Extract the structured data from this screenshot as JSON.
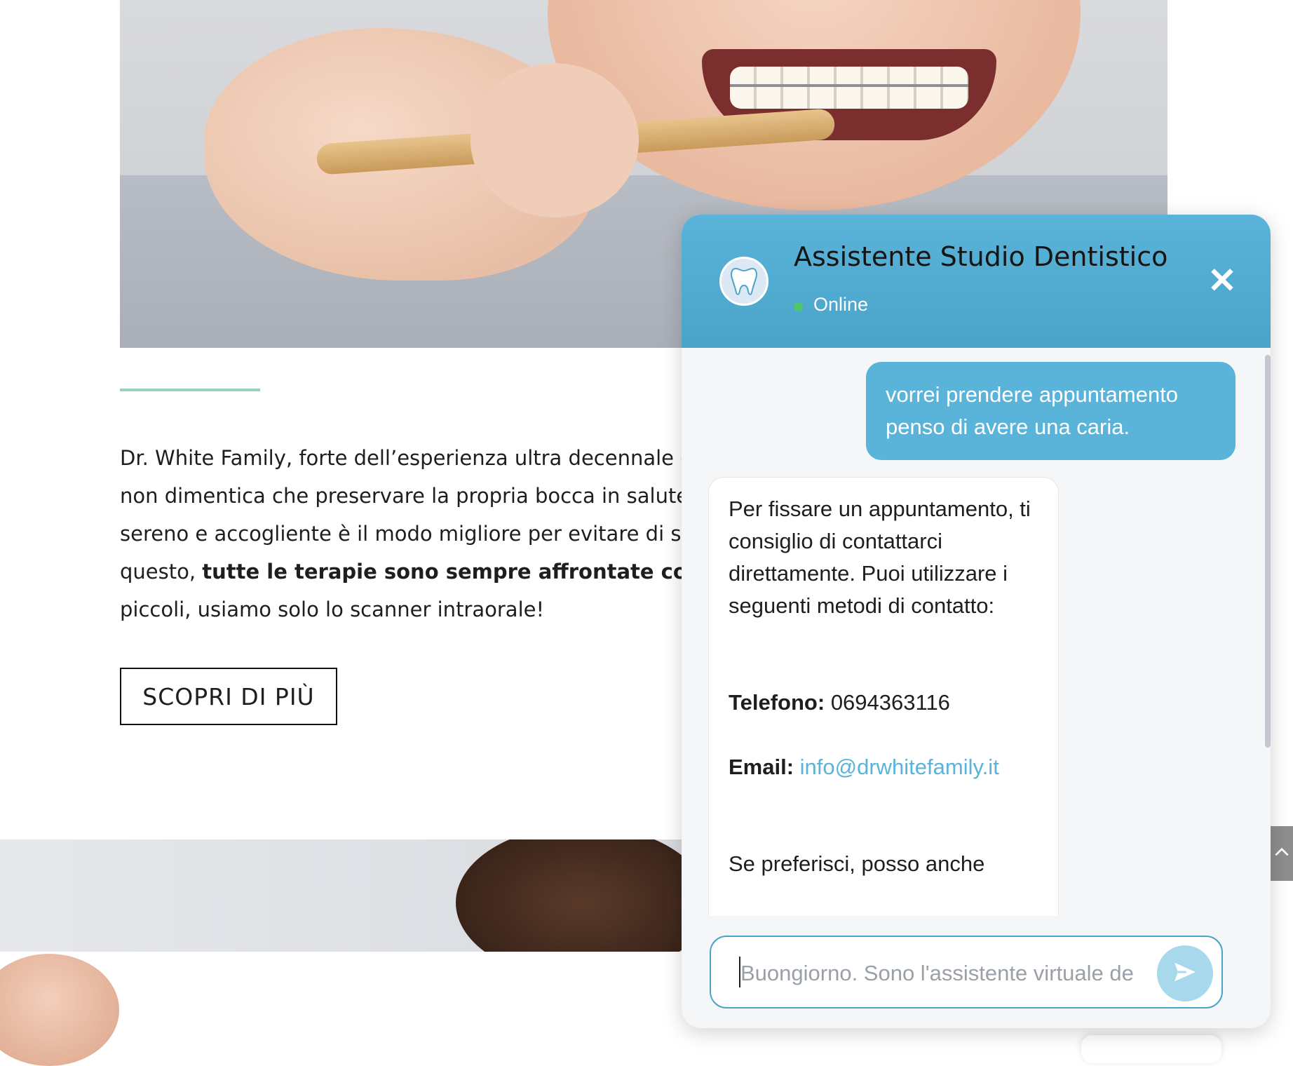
{
  "page": {
    "intro_line1": "Dr. White Family, forte dell’esperienza ultra decennale già",
    "intro_line2": "non dimentica che preservare la propria bocca in salute è f",
    "intro_line3": "sereno e accogliente è il modo migliore per evitare di svilu",
    "intro_line4_prefix": "questo, ",
    "intro_line4_bold": "tutte le terapie sono sempre affrontate con dolce",
    "intro_line5": "piccoli, usiamo solo lo scanner intraorale!",
    "more_button": "SCOPRI DI PIÙ",
    "scroll_top_icon": "^"
  },
  "chat": {
    "title": "Assistente Studio Dentistico",
    "status": "Online",
    "status_color": "#4ec86a",
    "close_icon": "✕",
    "avatar_icon": "tooth-icon",
    "messages": {
      "user": "vorrei prendere appuntamento penso di avere una caria.",
      "bot_intro": "Per fissare un appuntamento, ti consiglio di contattarci direttamente. Puoi utilizzare i seguenti metodi di contatto:",
      "phone_label": "Telefono:",
      "phone_value": "0694363116",
      "email_label": "Email:",
      "email_value": "info@drwhitefamily.it",
      "bot_outro": "Se preferisci, posso anche"
    },
    "input": {
      "placeholder": "Buongiorno. Sono l'assistente virtuale de",
      "send_icon": "send-icon"
    },
    "accent": "#5ab3d8"
  }
}
